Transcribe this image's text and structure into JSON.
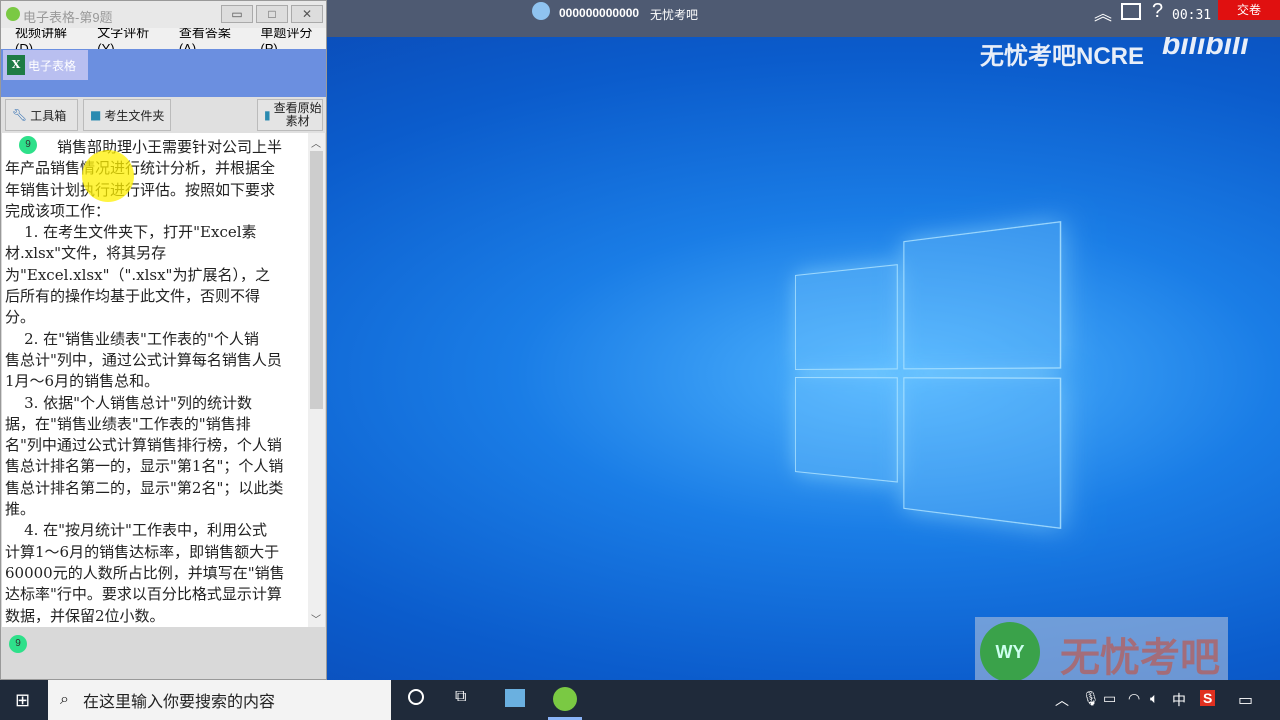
{
  "window": {
    "title": "电子表格-第9题",
    "menu": [
      "视频讲解(D)",
      "文字评析(Y)",
      "查看答案(A)",
      "单题评分(P)"
    ],
    "tab": "电子表格",
    "tools": {
      "toolbox": "工具箱",
      "student_folder": "考生文件夹",
      "view_original": [
        "查看原始",
        "素材"
      ]
    },
    "question_number": "9",
    "lines": [
      "销售部助理小王需要针对公司上半",
      "年产品销售情况进行统计分析，并根据全",
      "年销售计划执行进行评估。按照如下要求",
      "完成该项工作：",
      "    1. 在考生文件夹下，打开\"Excel素",
      "材.xlsx\"文件，将其另存",
      "为\"Excel.xlsx\"（\".xlsx\"为扩展名），之",
      "后所有的操作均基于此文件，否则不得",
      "分。",
      "    2. 在\"销售业绩表\"工作表的\"个人销",
      "售总计\"列中，通过公式计算每名销售人员",
      "1月～6月的销售总和。",
      "    3. 依据\"个人销售总计\"列的统计数",
      "据，在\"销售业绩表\"工作表的\"销售排",
      "名\"列中通过公式计算销售排行榜，个人销",
      "售总计排名第一的，显示\"第1名\"；个人销",
      "售总计排名第二的，显示\"第2名\"；以此类",
      "推。",
      "    4. 在\"按月统计\"工作表中，利用公式",
      "计算1～6月的销售达标率，即销售额大于",
      "60000元的人数所占比例，并填写在\"销售",
      "达标率\"行中。要求以百分比格式显示计算",
      "数据，并保留2位小数。"
    ],
    "bottom_badge": "9"
  },
  "topbar": {
    "user_id": "000000000000",
    "brand": "无忧考吧",
    "timer": "00:31",
    "submit": "交卷"
  },
  "watermark": {
    "ncre": "无忧考吧NCRE",
    "bili": "bilibili",
    "wy": "WY",
    "site_text": "无忧考吧"
  },
  "taskbar": {
    "search_placeholder": "在这里输入你要搜索的内容",
    "ime": "中"
  },
  "colors": {
    "submit": "#e01010",
    "accent": "#6b8fe0"
  }
}
